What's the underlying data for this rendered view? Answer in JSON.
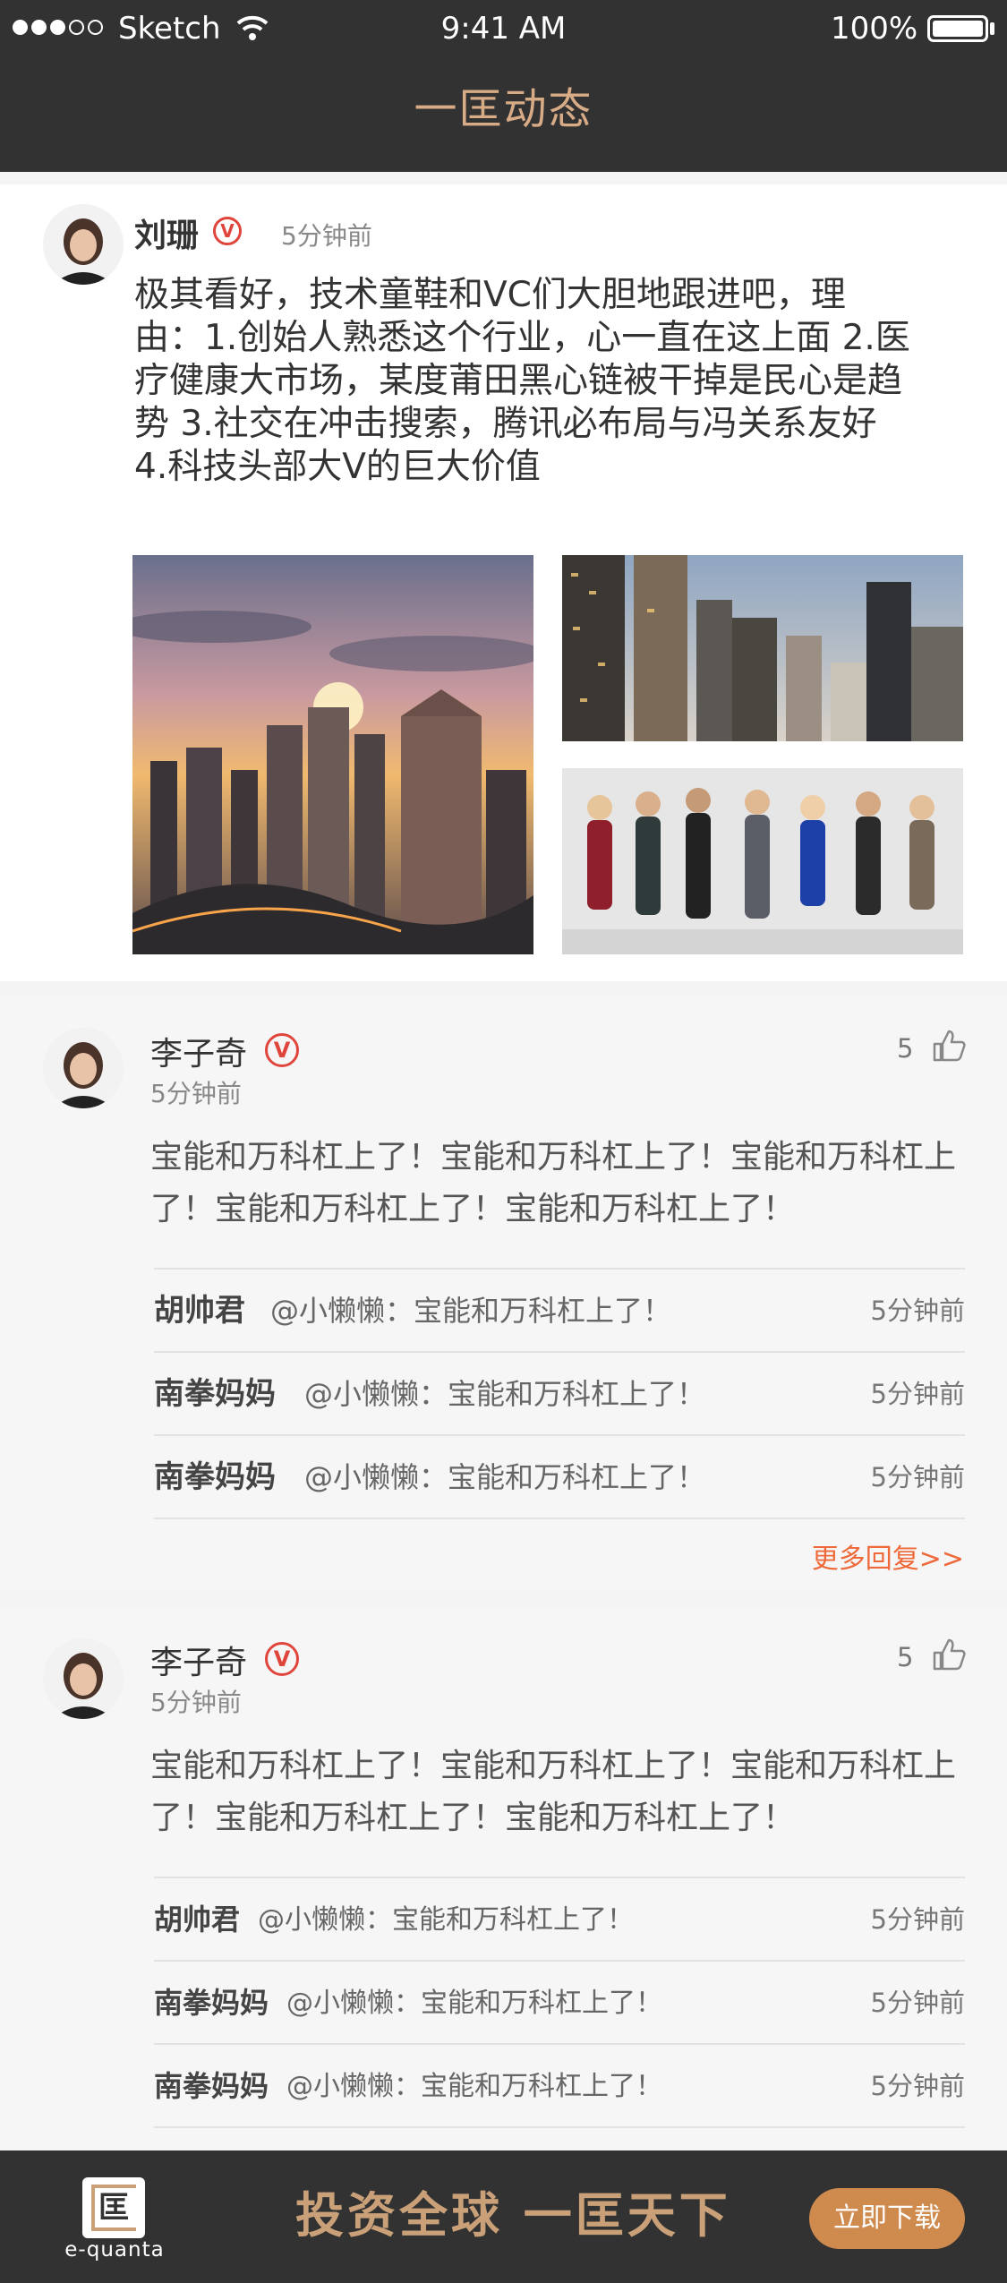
{
  "status_bar": {
    "carrier": "Sketch",
    "time": "9:41 AM",
    "battery": "100%"
  },
  "nav": {
    "title": "一匡动态"
  },
  "post": {
    "author": "刘珊",
    "verified_icon": "verified-v-icon",
    "time": "5分钟前",
    "content_lines": [
      "极其看好，技术童鞋和VC们大胆地跟进吧，理",
      "由：1.创始人熟悉这个行业，心一直在这上面 2.医",
      "疗健康大市场，某度莆田黑心链被干掉是民心是趋",
      "势 3.社交在冲击搜索，腾讯必布局与冯关系友好",
      "4.科技头部大V的巨大价值"
    ],
    "images": [
      "city-sunset-photo",
      "skyscrapers-photo",
      "group-photo"
    ]
  },
  "comments": [
    {
      "author": "李子奇",
      "time": "5分钟前",
      "likes": "5",
      "like_icon": "thumbs-up-icon",
      "text_lines": [
        "宝能和万科杠上了！宝能和万科杠上了！宝能和万科杠上",
        "了！宝能和万科杠上了！宝能和万科杠上了！"
      ],
      "replies": [
        {
          "name": "胡帅君",
          "text": "@小懒懒：宝能和万科杠上了！",
          "time": "5分钟前"
        },
        {
          "name": "南拳妈妈",
          "text": "@小懒懒：宝能和万科杠上了！",
          "time": "5分钟前"
        },
        {
          "name": "南拳妈妈",
          "text": "@小懒懒：宝能和万科杠上了！",
          "time": "5分钟前"
        }
      ],
      "more": "更多回复>>"
    },
    {
      "author": "李子奇",
      "time": "5分钟前",
      "likes": "5",
      "like_icon": "thumbs-up-icon",
      "text_lines": [
        "宝能和万科杠上了！宝能和万科杠上了！宝能和万科杠上",
        "了！宝能和万科杠上了！宝能和万科杠上了！"
      ],
      "replies": [
        {
          "name": "胡帅君",
          "text": "@小懒懒：宝能和万科杠上了！",
          "time": "5分钟前"
        },
        {
          "name": "南拳妈妈",
          "text": "@小懒懒：宝能和万科杠上了！",
          "time": "5分钟前"
        },
        {
          "name": "南拳妈妈",
          "text": "@小懒懒：宝能和万科杠上了！",
          "time": "5分钟前"
        }
      ]
    }
  ],
  "banner": {
    "logo_text": "e-quanta",
    "logo_glyph": "匡",
    "slogan": "投资全球 一匡天下",
    "download_label": "立即下载"
  },
  "colors": {
    "nav_bg": "#323232",
    "nav_title": "#d7ab85",
    "accent_orange": "#cf8a4d",
    "verified_red": "#e0453c",
    "more_link": "#ee6a3a"
  }
}
